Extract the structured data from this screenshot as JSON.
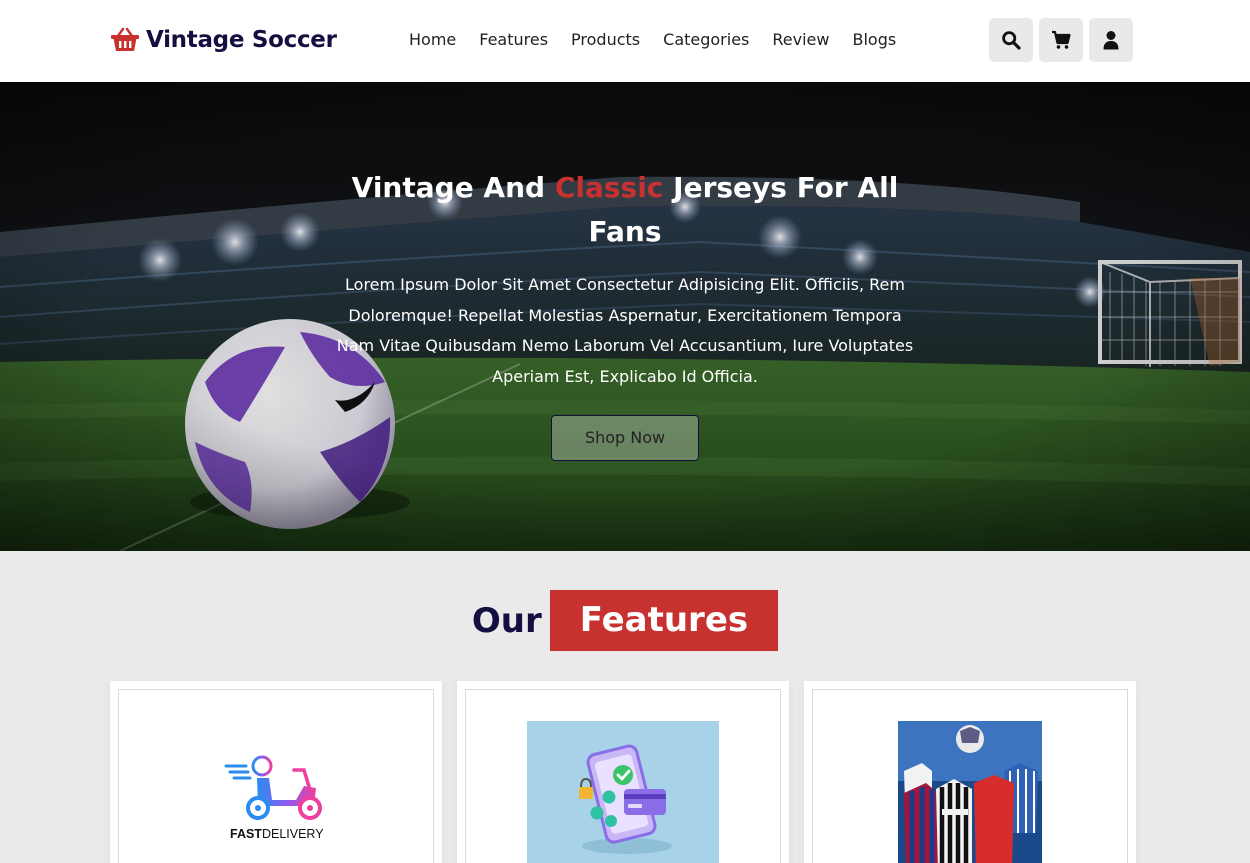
{
  "brand": {
    "name": "Vintage Soccer",
    "icon": "basket-icon",
    "accent": "#c7312f",
    "ink": "#130f40"
  },
  "nav": {
    "items": [
      {
        "label": "Home"
      },
      {
        "label": "Features"
      },
      {
        "label": "Products"
      },
      {
        "label": "Categories"
      },
      {
        "label": "Review"
      },
      {
        "label": "Blogs"
      }
    ]
  },
  "header_icons": [
    "search-icon",
    "cart-icon",
    "user-icon"
  ],
  "hero": {
    "title_before": "Vintage And ",
    "title_accent": "Classic",
    "title_after": " Jerseys For All Fans",
    "text": "Lorem Ipsum Dolor Sit Amet Consectetur Adipisicing Elit. Officiis, Rem Doloremque! Repellat Molestias Aspernatur, Exercitationem Tempora Nam Vitae Quibusdam Nemo Laborum Vel Accusantium, Iure Voluptates Aperiam Est, Explicabo Id Officia.",
    "button": "Shop Now"
  },
  "features": {
    "heading_plain": "Our",
    "heading_badge": "Features",
    "cards": [
      {
        "image": "fast-delivery-image",
        "image_text_fast": "FAST",
        "image_text_delivery": "DELIVERY"
      },
      {
        "image": "secure-payment-image"
      },
      {
        "image": "jerseys-image"
      }
    ]
  }
}
